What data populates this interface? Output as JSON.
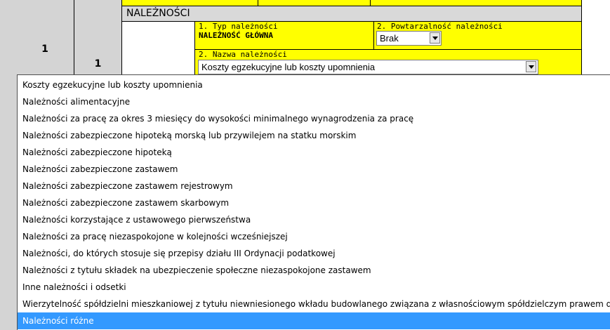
{
  "row": {
    "number_left": "1",
    "number_right": "1"
  },
  "section": {
    "title": "NALEŻNOŚCI"
  },
  "field_type": {
    "label": "1. Typ należności",
    "value": "NALEŻNOŚĆ GŁÓWNA"
  },
  "field_repeat": {
    "label": "2. Powtarzalność należności",
    "value": "Brak"
  },
  "field_name": {
    "label": "2. Nazwa należności",
    "value": "Koszty egzekucyjne lub koszty upomnienia"
  },
  "dropdown": {
    "options": [
      "Koszty egzekucyjne lub koszty upomnienia",
      "Należności alimentacyjne",
      "Należności za pracę za okres 3 miesięcy do wysokości minimalnego wynagrodzenia za pracę",
      "Należności zabezpieczone hipoteką morską lub przywilejem na statku morskim",
      "Należności zabezpieczone hipoteką",
      "Należności zabezpieczone zastawem",
      "Należności zabezpieczone zastawem rejestrowym",
      "Należności zabezpieczone zastawem skarbowym",
      "Należności korzystające z ustawowego pierwszeństwa",
      "Należności za pracę niezaspokojone w kolejności wcześniejszej",
      "Należności, do których stosuje się przepisy działu III Ordynacji podatkowej",
      "Należności z tytułu składek na ubezpieczenie społeczne niezaspokojone zastawem",
      "Inne należności i odsetki",
      "Wierzytelność spółdzielni mieszkaniowej z tytułu niewniesionego wkładu budowlanego związana z własnościowym spółdzielczym prawem do lokalu mieszkalnego",
      "Należności różne"
    ],
    "selected_index": 14
  },
  "colors": {
    "yellow": "#ffff00",
    "selection": "#3399ff",
    "gray": "#d4d4d4",
    "header_gray": "#d9d9d9"
  }
}
